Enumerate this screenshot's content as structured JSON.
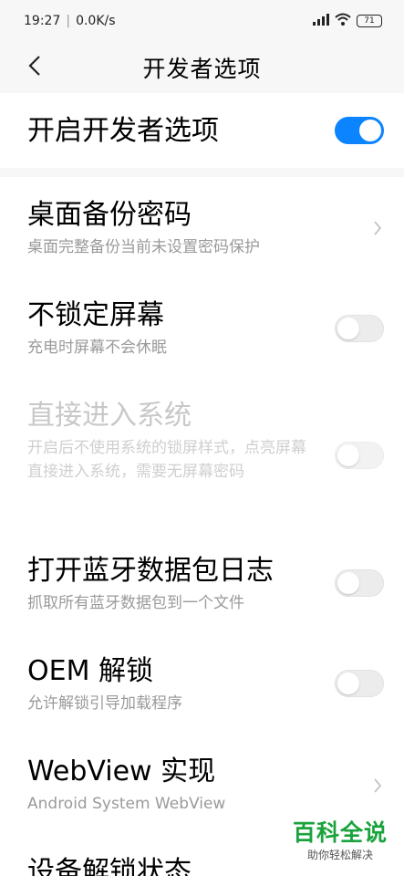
{
  "status_bar": {
    "time": "19:27",
    "separator": "|",
    "network_speed": "0.0K/s",
    "battery_level": "71",
    "icons": [
      "signal-icon",
      "wifi-icon",
      "battery-icon"
    ]
  },
  "header": {
    "title": "开发者选项",
    "back_icon": "chevron-left-icon"
  },
  "master_toggle": {
    "label": "开启开发者选项",
    "enabled": true
  },
  "settings": [
    {
      "title": "桌面备份密码",
      "subtitle": "桌面完整备份当前未设置密码保护",
      "control": "chevron",
      "disabled": false
    },
    {
      "title": "不锁定屏幕",
      "subtitle": "充电时屏幕不会休眠",
      "control": "toggle",
      "checked": false,
      "disabled": false
    },
    {
      "title": "直接进入系统",
      "subtitle": "开启后不使用系统的锁屏样式，点亮屏幕直接进入系统，需要无屏幕密码",
      "control": "toggle",
      "checked": false,
      "disabled": true
    },
    {
      "title": "打开蓝牙数据包日志",
      "subtitle": "抓取所有蓝牙数据包到一个文件",
      "control": "toggle",
      "checked": false,
      "disabled": false
    },
    {
      "title": "OEM 解锁",
      "subtitle": "允许解锁引导加载程序",
      "control": "toggle",
      "checked": false,
      "disabled": false
    },
    {
      "title": "WebView 实现",
      "subtitle": "Android System WebView",
      "control": "chevron",
      "disabled": false
    },
    {
      "title": "设备解锁状态",
      "subtitle": "",
      "control": "none",
      "disabled": false
    }
  ],
  "watermark": {
    "title": "百科全说",
    "subtitle": "助你轻松解决"
  },
  "colors": {
    "accent": "#0d84ff",
    "watermark_green": "#1aa33c",
    "subtitle_gray": "#9a9a9a"
  }
}
